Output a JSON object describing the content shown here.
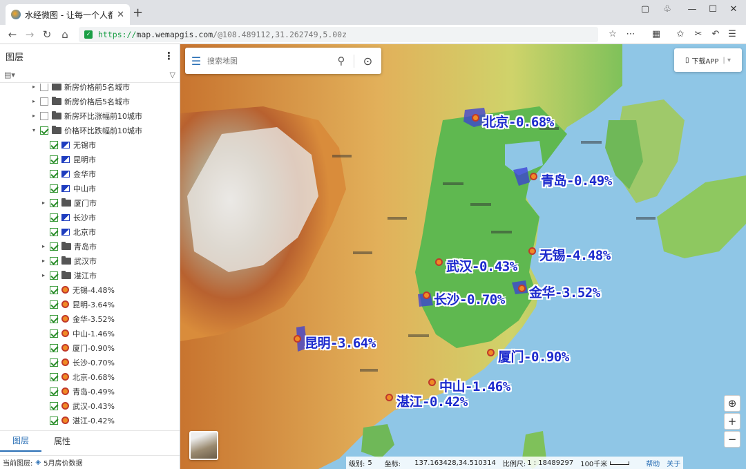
{
  "browser": {
    "tab_title": "水经微图 - 让每一个人都有自",
    "url_scheme": "https://",
    "url_host": "map.wemapgis.com",
    "url_rest": "/@108.489112,31.262749,5.00z"
  },
  "layers_panel": {
    "title": "图层",
    "items": [
      {
        "label": "新房价格前5名城市",
        "indent": 1,
        "arrow": "▸",
        "icon": "folder",
        "checked": false
      },
      {
        "label": "新房价格后5名城市",
        "indent": 1,
        "arrow": "▸",
        "icon": "folder",
        "checked": false
      },
      {
        "label": "新房环比涨幅前10城市",
        "indent": 1,
        "arrow": "▸",
        "icon": "folder",
        "checked": false
      },
      {
        "label": "价格环比跌幅前10城市",
        "indent": 1,
        "arrow": "▾",
        "icon": "folder-open",
        "checked": true
      },
      {
        "label": "无锡市",
        "indent": 2,
        "arrow": "",
        "icon": "polygon",
        "checked": true
      },
      {
        "label": "昆明市",
        "indent": 2,
        "arrow": "",
        "icon": "polygon",
        "checked": true
      },
      {
        "label": "金华市",
        "indent": 2,
        "arrow": "",
        "icon": "polygon",
        "checked": true
      },
      {
        "label": "中山市",
        "indent": 2,
        "arrow": "",
        "icon": "polygon",
        "checked": true
      },
      {
        "label": "厦门市",
        "indent": 2,
        "arrow": "▸",
        "icon": "folder",
        "checked": true
      },
      {
        "label": "长沙市",
        "indent": 2,
        "arrow": "",
        "icon": "polygon",
        "checked": true
      },
      {
        "label": "北京市",
        "indent": 2,
        "arrow": "",
        "icon": "polygon",
        "checked": true
      },
      {
        "label": "青岛市",
        "indent": 2,
        "arrow": "▸",
        "icon": "folder",
        "checked": true
      },
      {
        "label": "武汉市",
        "indent": 2,
        "arrow": "▸",
        "icon": "folder",
        "checked": true
      },
      {
        "label": "湛江市",
        "indent": 2,
        "arrow": "▸",
        "icon": "folder",
        "checked": true
      },
      {
        "label": "无锡-4.48%",
        "indent": 2,
        "arrow": "",
        "icon": "point",
        "checked": true
      },
      {
        "label": "昆明-3.64%",
        "indent": 2,
        "arrow": "",
        "icon": "point",
        "checked": true
      },
      {
        "label": "金华-3.52%",
        "indent": 2,
        "arrow": "",
        "icon": "point",
        "checked": true
      },
      {
        "label": "中山-1.46%",
        "indent": 2,
        "arrow": "",
        "icon": "point",
        "checked": true
      },
      {
        "label": "厦门-0.90%",
        "indent": 2,
        "arrow": "",
        "icon": "point",
        "checked": true
      },
      {
        "label": "长沙-0.70%",
        "indent": 2,
        "arrow": "",
        "icon": "point",
        "checked": true
      },
      {
        "label": "北京-0.68%",
        "indent": 2,
        "arrow": "",
        "icon": "point",
        "checked": true
      },
      {
        "label": "青岛-0.49%",
        "indent": 2,
        "arrow": "",
        "icon": "point",
        "checked": true
      },
      {
        "label": "武汉-0.43%",
        "indent": 2,
        "arrow": "",
        "icon": "point",
        "checked": true
      },
      {
        "label": "湛江-0.42%",
        "indent": 2,
        "arrow": "",
        "icon": "point",
        "checked": true
      }
    ],
    "tabs": [
      "图层",
      "属性"
    ],
    "current_layer_label": "当前图层:",
    "current_layer_value": "5月房价数据"
  },
  "map": {
    "search_placeholder": "搜索地图",
    "download_app": "下载APP",
    "zoom_in": "+",
    "zoom_out": "−",
    "status": {
      "level_label": "级别:",
      "level_value": "5",
      "coord_label": "坐标:",
      "coord_value": "137.163428,34.510314",
      "scale_label": "比例尺:",
      "scale_value": "1 : 18489297",
      "scalebar": "100千米",
      "help": "帮助",
      "about": "关于"
    },
    "city_labels": [
      {
        "text": "北京-0.68%"
      },
      {
        "text": "青岛-0.49%"
      },
      {
        "text": "无锡-4.48%"
      },
      {
        "text": "武汉-0.43%"
      },
      {
        "text": "金华-3.52%"
      },
      {
        "text": "长沙-0.70%"
      },
      {
        "text": "昆明-3.64%"
      },
      {
        "text": "厦门-0.90%"
      },
      {
        "text": "中山-1.46%"
      },
      {
        "text": "湛江-0.42%"
      }
    ]
  }
}
